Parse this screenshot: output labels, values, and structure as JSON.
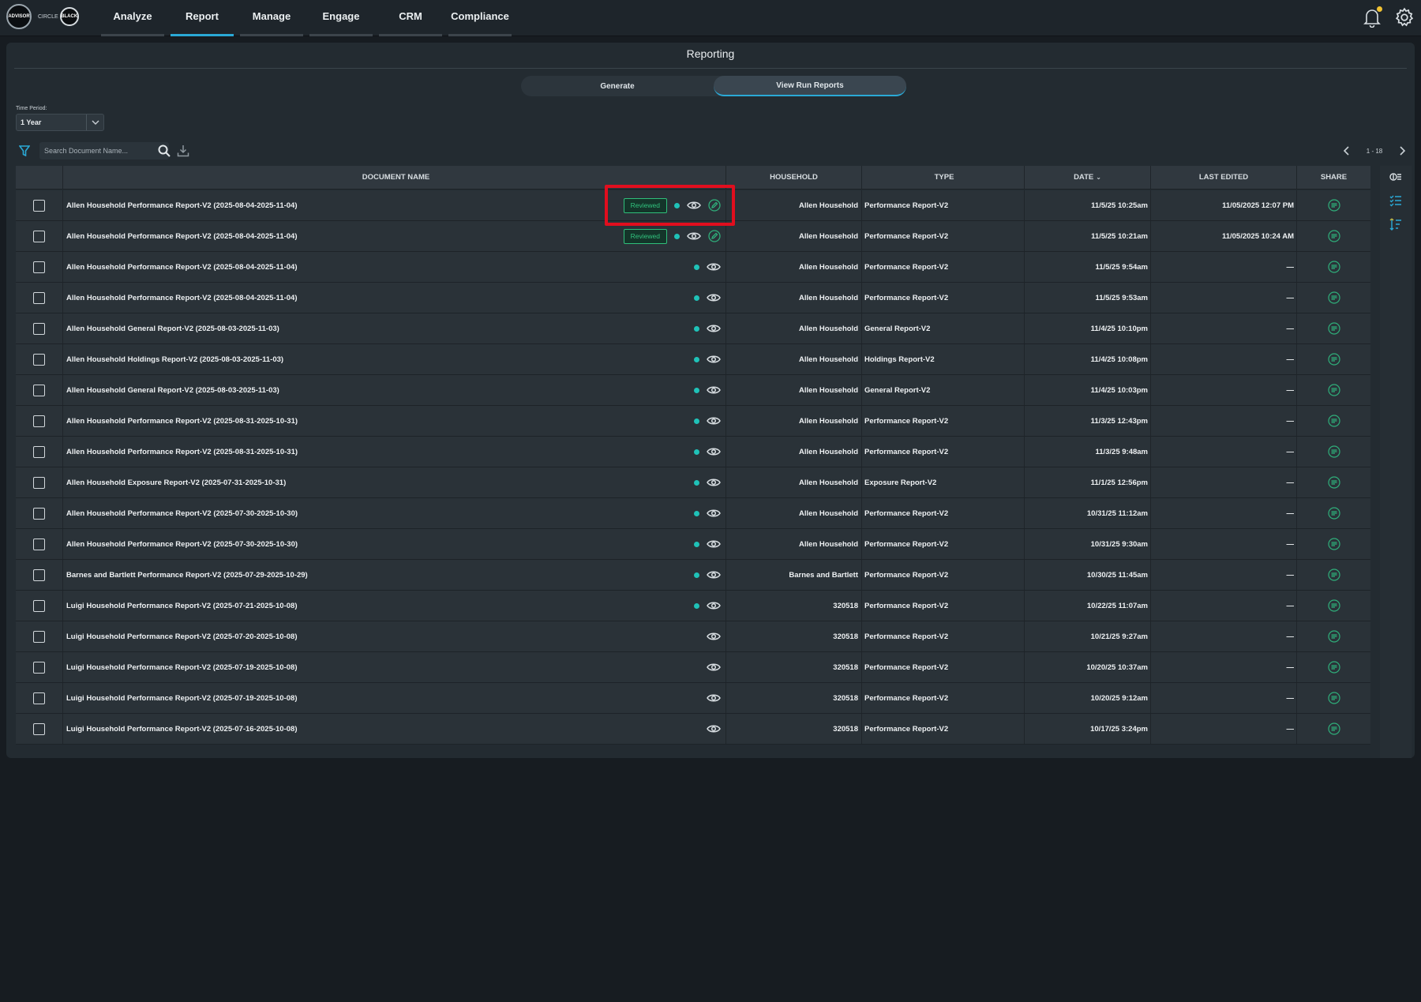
{
  "logos": {
    "advisor": "ADVISOR",
    "circle_left": "CIRCLE",
    "circle_ring": "BLACK"
  },
  "nav": {
    "items": [
      "Analyze",
      "Report",
      "Manage",
      "Engage",
      "CRM",
      "Compliance"
    ],
    "active_index": 1
  },
  "panel": {
    "title": "Reporting",
    "toggle": {
      "generate": "Generate",
      "view_run_reports": "View Run Reports",
      "active": "view_run_reports"
    },
    "time_period": {
      "label": "Time Period:",
      "value": "1 Year"
    },
    "search": {
      "placeholder": "Search Document Name..."
    },
    "pager": {
      "range": "1 - 18"
    }
  },
  "table": {
    "headers": {
      "document_name": "DOCUMENT NAME",
      "household": "HOUSEHOLD",
      "type": "TYPE",
      "date": "DATE",
      "last_edited": "LAST EDITED",
      "share": "SHARE"
    },
    "rows": [
      {
        "name": "Allen Household Performance Report-V2 (2025-08-04-2025-11-04)",
        "reviewed": "Reviewed",
        "dot": true,
        "edit": true,
        "household": "Allen Household",
        "type": "Performance Report-V2",
        "date": "11/5/25 10:25am",
        "last_edited": "11/05/2025 12:07 PM"
      },
      {
        "name": "Allen Household Performance Report-V2 (2025-08-04-2025-11-04)",
        "reviewed": "Reviewed",
        "dot": true,
        "edit": true,
        "household": "Allen Household",
        "type": "Performance Report-V2",
        "date": "11/5/25 10:21am",
        "last_edited": "11/05/2025 10:24 AM"
      },
      {
        "name": "Allen Household Performance Report-V2 (2025-08-04-2025-11-04)",
        "reviewed": "",
        "dot": true,
        "edit": false,
        "household": "Allen Household",
        "type": "Performance Report-V2",
        "date": "11/5/25 9:54am",
        "last_edited": "—"
      },
      {
        "name": "Allen Household Performance Report-V2 (2025-08-04-2025-11-04)",
        "reviewed": "",
        "dot": true,
        "edit": false,
        "household": "Allen Household",
        "type": "Performance Report-V2",
        "date": "11/5/25 9:53am",
        "last_edited": "—"
      },
      {
        "name": "Allen Household General Report-V2 (2025-08-03-2025-11-03)",
        "reviewed": "",
        "dot": true,
        "edit": false,
        "household": "Allen Household",
        "type": "General Report-V2",
        "date": "11/4/25 10:10pm",
        "last_edited": "—"
      },
      {
        "name": "Allen Household Holdings Report-V2 (2025-08-03-2025-11-03)",
        "reviewed": "",
        "dot": true,
        "edit": false,
        "household": "Allen Household",
        "type": "Holdings Report-V2",
        "date": "11/4/25 10:08pm",
        "last_edited": "—"
      },
      {
        "name": "Allen Household General Report-V2 (2025-08-03-2025-11-03)",
        "reviewed": "",
        "dot": true,
        "edit": false,
        "household": "Allen Household",
        "type": "General Report-V2",
        "date": "11/4/25 10:03pm",
        "last_edited": "—"
      },
      {
        "name": "Allen Household Performance Report-V2 (2025-08-31-2025-10-31)",
        "reviewed": "",
        "dot": true,
        "edit": false,
        "household": "Allen Household",
        "type": "Performance Report-V2",
        "date": "11/3/25 12:43pm",
        "last_edited": "—"
      },
      {
        "name": "Allen Household Performance Report-V2 (2025-08-31-2025-10-31)",
        "reviewed": "",
        "dot": true,
        "edit": false,
        "household": "Allen Household",
        "type": "Performance Report-V2",
        "date": "11/3/25 9:48am",
        "last_edited": "—"
      },
      {
        "name": "Allen Household Exposure Report-V2 (2025-07-31-2025-10-31)",
        "reviewed": "",
        "dot": true,
        "edit": false,
        "household": "Allen Household",
        "type": "Exposure Report-V2",
        "date": "11/1/25 12:56pm",
        "last_edited": "—"
      },
      {
        "name": "Allen Household Performance Report-V2 (2025-07-30-2025-10-30)",
        "reviewed": "",
        "dot": true,
        "edit": false,
        "household": "Allen Household",
        "type": "Performance Report-V2",
        "date": "10/31/25 11:12am",
        "last_edited": "—"
      },
      {
        "name": "Allen Household Performance Report-V2 (2025-07-30-2025-10-30)",
        "reviewed": "",
        "dot": true,
        "edit": false,
        "household": "Allen Household",
        "type": "Performance Report-V2",
        "date": "10/31/25 9:30am",
        "last_edited": "—"
      },
      {
        "name": "Barnes and Bartlett Performance Report-V2 (2025-07-29-2025-10-29)",
        "reviewed": "",
        "dot": true,
        "edit": false,
        "household": "Barnes and Bartlett",
        "type": "Performance Report-V2",
        "date": "10/30/25 11:45am",
        "last_edited": "—"
      },
      {
        "name": "Luigi Household Performance Report-V2 (2025-07-21-2025-10-08)",
        "reviewed": "",
        "dot": true,
        "edit": false,
        "household": "320518",
        "type": "Performance Report-V2",
        "date": "10/22/25 11:07am",
        "last_edited": "—"
      },
      {
        "name": "Luigi Household Performance Report-V2 (2025-07-20-2025-10-08)",
        "reviewed": "",
        "dot": false,
        "edit": false,
        "household": "320518",
        "type": "Performance Report-V2",
        "date": "10/21/25 9:27am",
        "last_edited": "—"
      },
      {
        "name": "Luigi Household Performance Report-V2 (2025-07-19-2025-10-08)",
        "reviewed": "",
        "dot": false,
        "edit": false,
        "household": "320518",
        "type": "Performance Report-V2",
        "date": "10/20/25 10:37am",
        "last_edited": "—"
      },
      {
        "name": "Luigi Household Performance Report-V2 (2025-07-19-2025-10-08)",
        "reviewed": "",
        "dot": false,
        "edit": false,
        "household": "320518",
        "type": "Performance Report-V2",
        "date": "10/20/25 9:12am",
        "last_edited": "—"
      },
      {
        "name": "Luigi Household Performance Report-V2 (2025-07-16-2025-10-08)",
        "reviewed": "",
        "dot": false,
        "edit": false,
        "household": "320518",
        "type": "Performance Report-V2",
        "date": "10/17/25 3:24pm",
        "last_edited": "—"
      }
    ]
  },
  "icons": {
    "filter": "filter-icon",
    "search": "search-icon",
    "download": "download-icon",
    "bell": "bell-icon",
    "gear": "gear-icon",
    "eye": "eye-icon",
    "edit": "edit-icon",
    "share": "share-icon",
    "columns": "columns-icon",
    "checklist": "checklist-icon",
    "sort-list": "sort-list-icon"
  },
  "colors": {
    "accent": "#2aa9d6",
    "status_dot": "#1fc2b8",
    "reviewed_badge": "#31c37e",
    "highlight": "#e10e1e",
    "notification_dot": "#f1c232"
  }
}
